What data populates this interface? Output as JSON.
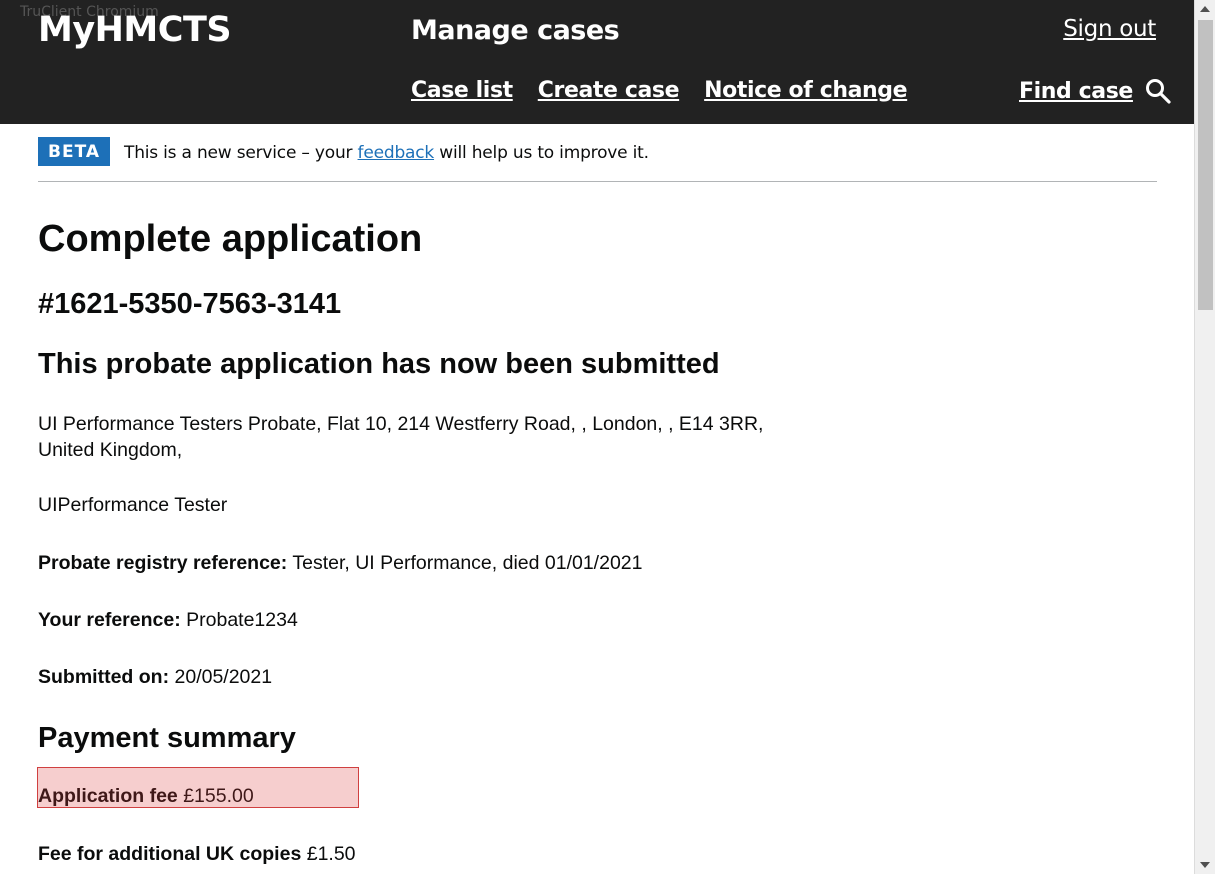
{
  "browser": {
    "overlay_label": "TruClient Chromium"
  },
  "header": {
    "logo": "MyHMCTS",
    "service_name": "Manage cases",
    "sign_out": "Sign out",
    "nav": [
      "Case list",
      "Create case",
      "Notice of change"
    ],
    "find_case": "Find case",
    "find_case_icon": "search-icon"
  },
  "beta": {
    "tag": "BETA",
    "text_before": "This is a new service – your ",
    "link": "feedback",
    "text_after": " will help us to improve it."
  },
  "main": {
    "title": "Complete application",
    "case_number": "#1621-5350-7563-3141",
    "status_heading": "This probate application has now been submitted",
    "address_line1": "UI Performance Testers Probate, Flat 10, 214 Westferry Road, , London, , E14 3RR,",
    "address_line2": "United Kingdom,",
    "applicant_name": "UIPerformance Tester",
    "registry_ref_label": "Probate registry reference:",
    "registry_ref_value": "Tester, UI Performance, died 01/01/2021",
    "your_ref_label": "Your reference:",
    "your_ref_value": "Probate1234",
    "submitted_label": "Submitted on:",
    "submitted_value": "20/05/2021"
  },
  "payment": {
    "title": "Payment summary",
    "application_fee_label": "Application fee",
    "application_fee_value": "£155.00",
    "uk_copies_label": "Fee for additional UK copies",
    "uk_copies_value": "£1.50"
  },
  "colors": {
    "header_bg": "#222222",
    "beta_tag": "#1d70b8",
    "link": "#1d70b8",
    "highlight": "#d04040"
  }
}
